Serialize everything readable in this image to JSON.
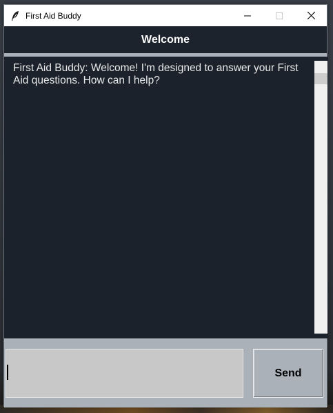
{
  "window": {
    "title": "First Aid Buddy",
    "icon": "feather-icon",
    "controls": [
      "minimize-icon",
      "maximize-icon",
      "close-icon"
    ]
  },
  "header": {
    "title": "Welcome"
  },
  "chat": {
    "message": "First Aid Buddy: Welcome! I'm designed to answer your First\nAid questions. How can I help?"
  },
  "composer": {
    "input_value": "",
    "send_label": "Send"
  },
  "colors": {
    "header_bg": "#1c232d",
    "chat_bg": "#1b222c",
    "frame_bg": "#aab1b9",
    "input_bg": "#c8c8c8"
  }
}
